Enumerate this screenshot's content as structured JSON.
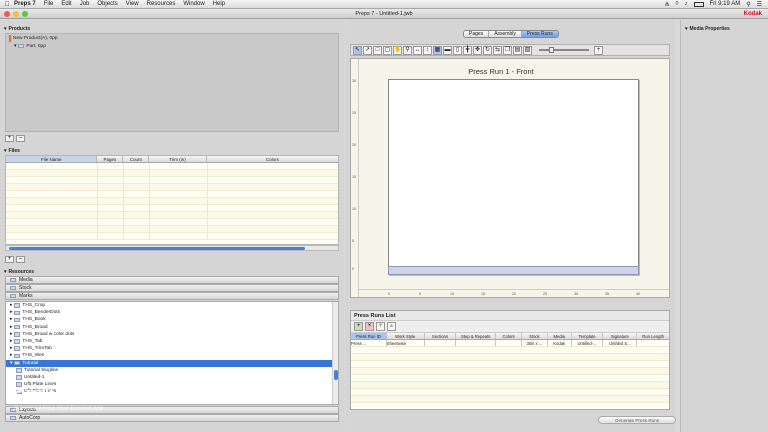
{
  "menubar": {
    "app_name": "Preps 7",
    "items": [
      "File",
      "Edit",
      "Job",
      "Objects",
      "View",
      "Resources",
      "Window",
      "Help"
    ],
    "clock": "Fri 9:19 AM"
  },
  "window": {
    "title": "Preps 7 - Untitled-1.jwb",
    "brand": "Kodak"
  },
  "products": {
    "header": "Products",
    "tree": [
      "New Product(A), 0pp",
      "Part, 0pp"
    ]
  },
  "files": {
    "header": "Files",
    "columns": [
      "File Name",
      "Pages",
      "Count",
      "Trim (in)",
      "Colors"
    ]
  },
  "resources": {
    "header": "Resources",
    "categories": [
      "Media",
      "Stock",
      "Marks"
    ],
    "marks": [
      "THS_Crop",
      "THS_BenderDots",
      "THS_Book",
      "THS_Broad",
      "THS_Broad w color dots",
      "THS_Tab",
      "THS_TrimTab",
      "THS_Wes",
      "Tutorial",
      "Tutorial Slugline",
      "Untitled-1",
      "Ufit Plate Lines",
      "Ufit Plate Lines"
    ],
    "selected": "Tutorial",
    "categories_bottom": [
      "Layouts",
      "AutoCorp"
    ]
  },
  "tabs": [
    "Pages",
    "Assembly",
    "Press Runs"
  ],
  "active_tab": "Press Runs",
  "canvas": {
    "title": "Press Run 1 - Front",
    "ruler_h": [
      "0",
      "5",
      "10",
      "15",
      "20",
      "25",
      "30",
      "35",
      "40"
    ],
    "ruler_v": [
      "30",
      "25",
      "20",
      "15",
      "10",
      "5",
      "0"
    ]
  },
  "press_runs": {
    "header": "Press Runs List",
    "columns": [
      "Press Run ID",
      "Work Style",
      "Sections",
      "Step & Repeats",
      "Colors",
      "Stock",
      "Media",
      "Template",
      "Signature",
      "Run Length"
    ],
    "rows": [
      [
        "Press ...",
        "Sheetwise",
        "",
        "",
        "",
        "30in x ...",
        "Kodak",
        "Untitled-...",
        "Untitled S...",
        ""
      ]
    ],
    "generate_label": "Generate Press Runs"
  },
  "media_properties": {
    "header": "Media Properties"
  },
  "watermark": {
    "main": "GETINTO PC",
    "sub": "Download Free Your Desired App"
  },
  "colors": {
    "accent": "#3875d7",
    "brand": "#c8102e"
  }
}
